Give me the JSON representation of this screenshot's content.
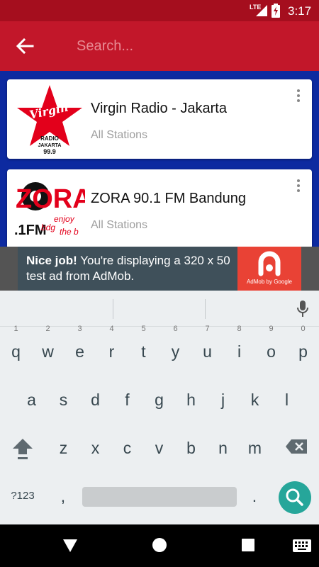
{
  "status_bar": {
    "network": "LTE",
    "time": "3:17"
  },
  "search": {
    "placeholder": "Search..."
  },
  "stations": [
    {
      "name": "Virgin Radio - Jakarta",
      "category": "All Stations",
      "logo": {
        "line1": "Virgin",
        "line2": "RADIO",
        "line3": "JAKARTA",
        "line4": "99.9"
      }
    },
    {
      "name": "ZORA 90.1 FM Bandung",
      "category": "All Stations",
      "logo": {
        "line1": "ZORA",
        "line2": ".1FM",
        "line3": "bdg",
        "line4": "enjoy",
        "line5": "the b"
      }
    }
  ],
  "ad": {
    "bold": "Nice job!",
    "text": " You're displaying a 320 x 50 test ad from AdMob.",
    "brand": "AdMob by Google"
  },
  "keyboard": {
    "row1": [
      {
        "k": "q",
        "h": "1"
      },
      {
        "k": "w",
        "h": "2"
      },
      {
        "k": "e",
        "h": "3"
      },
      {
        "k": "r",
        "h": "4"
      },
      {
        "k": "t",
        "h": "5"
      },
      {
        "k": "y",
        "h": "6"
      },
      {
        "k": "u",
        "h": "7"
      },
      {
        "k": "i",
        "h": "8"
      },
      {
        "k": "o",
        "h": "9"
      },
      {
        "k": "p",
        "h": "0"
      }
    ],
    "row2": [
      "a",
      "s",
      "d",
      "f",
      "g",
      "h",
      "j",
      "k",
      "l"
    ],
    "row3": [
      "z",
      "x",
      "c",
      "v",
      "b",
      "n",
      "m"
    ],
    "symbols": "?123",
    "comma": ",",
    "period": "."
  },
  "colors": {
    "app_bar": "#c2172a",
    "status_bar": "#a50e1e",
    "list_bg": "#0d2aa0",
    "search_key": "#26a69a"
  },
  "icons": [
    "back-arrow-icon",
    "overflow-menu-icon",
    "mic-icon",
    "shift-icon",
    "backspace-icon",
    "search-icon",
    "nav-back-icon",
    "nav-home-icon",
    "nav-recents-icon",
    "keyboard-switch-icon"
  ]
}
